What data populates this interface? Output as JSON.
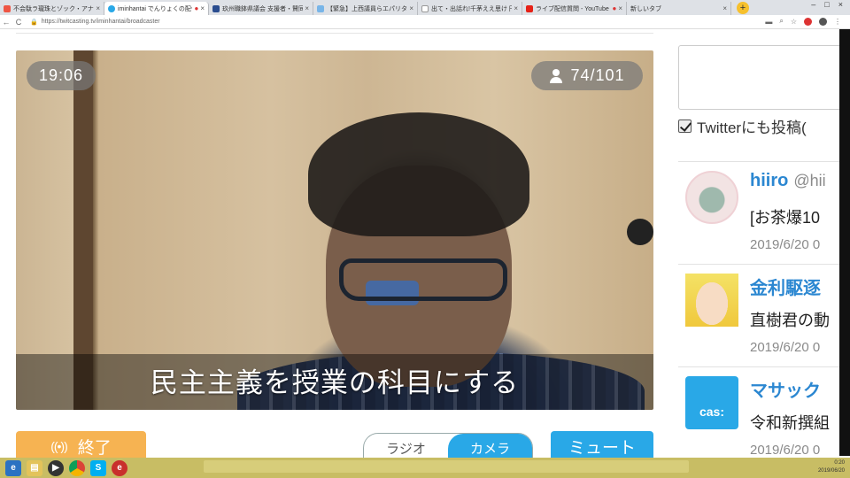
{
  "browser": {
    "tabs": [
      {
        "label": "不会駄ラ瓏珠とゾック・アナリシス(",
        "icon_color": "#e54",
        "active": false
      },
      {
        "label": "iminhantai でんりょくの配信",
        "icon_color": "#29a8e7",
        "active": true
      },
      {
        "label": "玖州職鉢県議会 支援者・賛同者数",
        "icon_color": "#2a4d8f",
        "active": false
      },
      {
        "label": "【緊急】上西議員らエパリタチ ク",
        "icon_color": "#78b5e8",
        "active": false
      },
      {
        "label": "出て・出話れ!千茅ええ思け 円港",
        "icon_color": "#9a9",
        "active": false
      },
      {
        "label": "ライブ配信質問 - YouTube",
        "icon_color": "#e62117",
        "active": false
      },
      {
        "label": "新しいタブ",
        "icon_color": "#ddd",
        "active": false
      }
    ],
    "new_tab": "+",
    "window_controls": [
      "–",
      "□",
      "×"
    ],
    "url": "https://twitcasting.tv/iminhantai/broadcaster",
    "nav": {
      "back": "←",
      "reload": "C"
    }
  },
  "video": {
    "elapsed_time": "19:06",
    "viewers": "74/101",
    "caption": "民主主義を授業の科目にする"
  },
  "controls": {
    "end_label": "終了",
    "end_icon": "((•))",
    "mode_options": [
      "ラジオ",
      "カメラ"
    ],
    "mode_selected": "カメラ",
    "mute_label": "ミュート"
  },
  "sidebar": {
    "twitter_checkbox_label": "Twitterにも投稿(",
    "twitter_checked": true,
    "comments": [
      {
        "name": "hiiro",
        "handle": "@hii",
        "text": "[お茶爆10",
        "date": "2019/6/20 0"
      },
      {
        "name": "金利駆逐 ",
        "handle": "",
        "text": "直樹君の動",
        "date": "2019/6/20 0"
      },
      {
        "name": "マサック ",
        "handle": "",
        "text": "令和新撰組",
        "date": "2019/6/20 0"
      }
    ],
    "cas_label": "cas:"
  },
  "taskbar": {
    "clock_time": "0:20",
    "clock_date": "2019/06/20"
  },
  "colors": {
    "accent_blue": "#29a8e7",
    "end_orange": "#f6b352",
    "name_blue": "#2b87d1",
    "taskbar": "#c8bd64"
  }
}
